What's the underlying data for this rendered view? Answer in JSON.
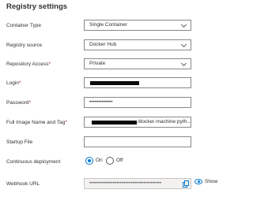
{
  "section": {
    "title": "Registry settings"
  },
  "fields": {
    "container_type": {
      "label": "Container Type",
      "value": "Single Container"
    },
    "registry_source": {
      "label": "Registry source",
      "value": "Docker Hub"
    },
    "repository_access": {
      "label": "Repository Access",
      "required_mark": "*",
      "value": "Private"
    },
    "login": {
      "label": "Login",
      "required_mark": "*"
    },
    "password": {
      "label": "Password",
      "required_mark": "*",
      "value": "•••••••••••••"
    },
    "image_tag": {
      "label": "Full Image Name and Tag",
      "required_mark": "*",
      "value": "/docker-machine:pyth..."
    },
    "startup_file": {
      "label": "Startup File",
      "value": ""
    },
    "continuous_deployment": {
      "label": "Continuous deployment",
      "on_label": "On",
      "off_label": "Off",
      "selected": "On"
    },
    "webhook_url": {
      "label": "Webhook URL",
      "value": "••••••••••••••••••••••••••••••••••••••••",
      "show_label": "Show"
    }
  },
  "colors": {
    "accent": "#0078d4",
    "required": "#a4262c",
    "border": "#8a8886",
    "redaction": "#0a0a0a"
  },
  "icons": {
    "dropdown": "chevron-down-icon",
    "copy": "copy-icon",
    "show": "eye-icon"
  }
}
